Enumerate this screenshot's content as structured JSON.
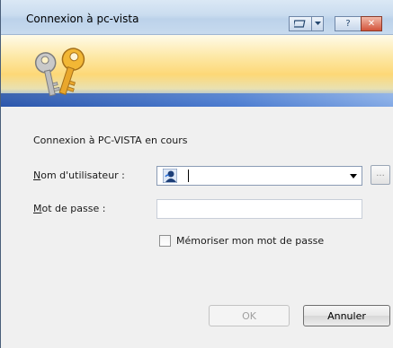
{
  "window": {
    "title": "Connexion à pc-vista",
    "buttons": {
      "help": "?",
      "close": "✕"
    }
  },
  "dialog": {
    "status_text": "Connexion à PC-VISTA en cours",
    "username_label_accel": "N",
    "username_label_rest": "om d'utilisateur :",
    "username_value": "",
    "browse_label": "...",
    "password_label_accel": "M",
    "password_label_rest": "ot de passe :",
    "password_value": "",
    "remember_label": "Mémoriser mon mot de passe",
    "remember_checked": false,
    "ok_label": "OK",
    "cancel_label": "Annuler"
  },
  "colors": {
    "banner_gold": "#fdd877",
    "banner_blue": "#3868c1",
    "close_red": "#d2533a"
  },
  "icons": [
    "keys-icon",
    "user-account-icon",
    "window-switch-icon",
    "help-icon",
    "close-icon",
    "dropdown-arrow-icon"
  ]
}
